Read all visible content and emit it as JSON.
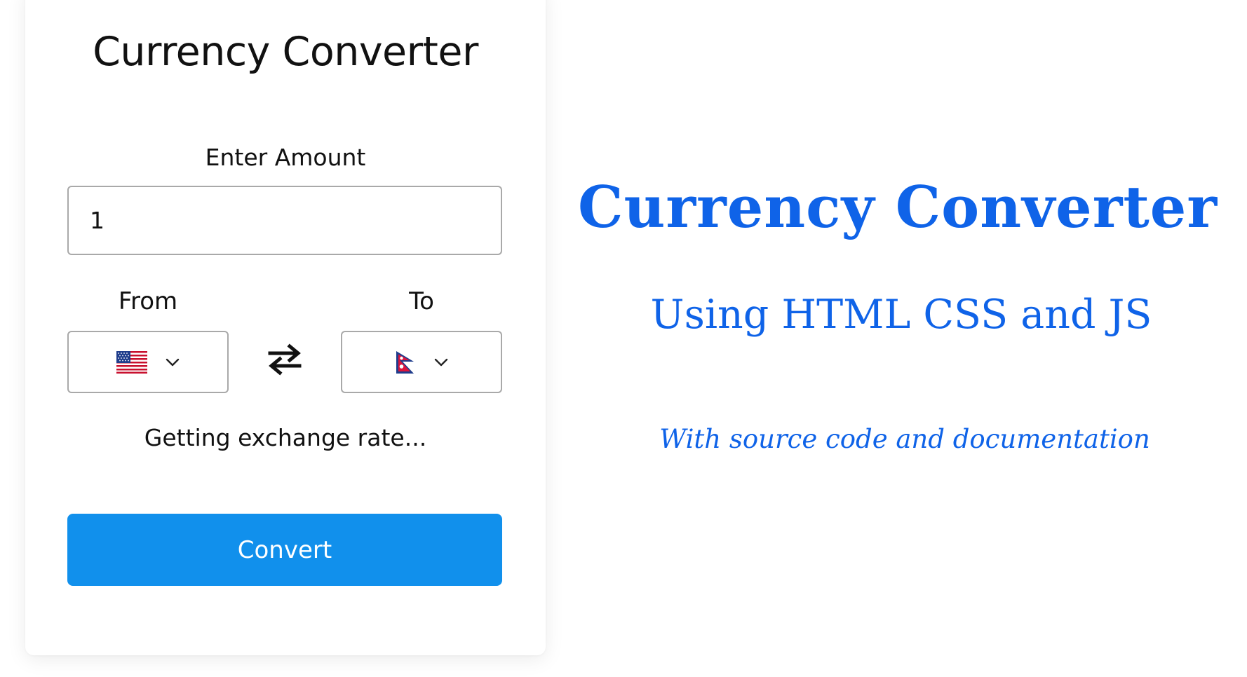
{
  "converter": {
    "title": "Currency Converter",
    "amount_label": "Enter Amount",
    "amount_value": "1",
    "from_label": "From",
    "to_label": "To",
    "from_currency_flag": "us-flag-icon",
    "to_currency_flag": "nepal-flag-icon",
    "rate_status": "Getting exchange rate...",
    "convert_label": "Convert"
  },
  "hero": {
    "title": "Currency Converter",
    "subtitle": "Using HTML CSS and JS",
    "note": "With source code and documentation"
  },
  "colors": {
    "accent_blue": "#0f63e8",
    "button_blue": "#1190ec",
    "border_gray": "#a9a9a9"
  }
}
